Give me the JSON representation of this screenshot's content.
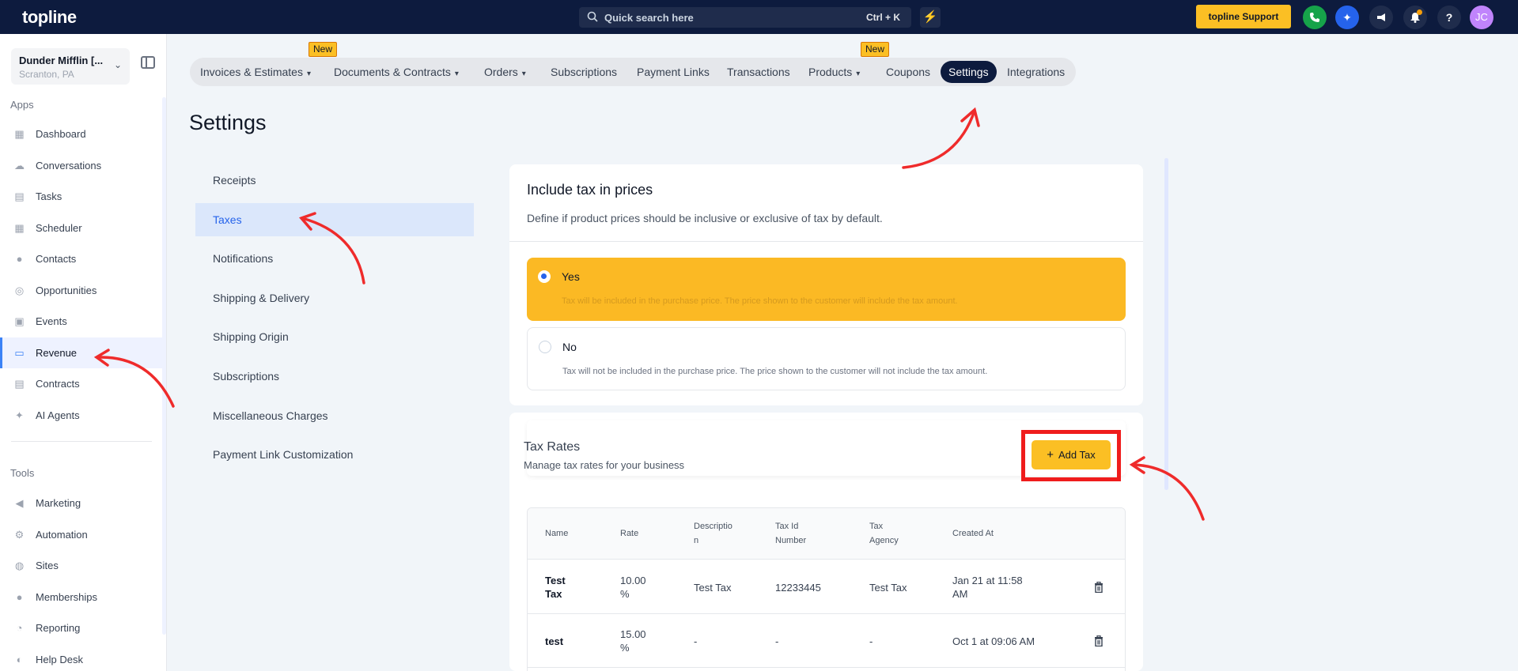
{
  "topbar": {
    "logo": "topline",
    "search_placeholder": "Quick search here",
    "search_shortcut": "Ctrl + K",
    "support_label": "topline Support",
    "avatar_initials": "JC"
  },
  "sidebar": {
    "account_name": "Dunder Mifflin [...",
    "account_location": "Scranton, PA",
    "apps_label": "Apps",
    "apps": [
      {
        "label": "Dashboard",
        "icon": "dashboard-icon"
      },
      {
        "label": "Conversations",
        "icon": "chat-icon"
      },
      {
        "label": "Tasks",
        "icon": "tasks-icon"
      },
      {
        "label": "Scheduler",
        "icon": "calendar-icon"
      },
      {
        "label": "Contacts",
        "icon": "user-icon"
      },
      {
        "label": "Opportunities",
        "icon": "target-icon"
      },
      {
        "label": "Events",
        "icon": "events-icon"
      },
      {
        "label": "Revenue",
        "icon": "card-icon",
        "active": true
      },
      {
        "label": "Contracts",
        "icon": "document-icon"
      },
      {
        "label": "AI Agents",
        "icon": "sparkle-icon"
      }
    ],
    "tools_label": "Tools",
    "tools": [
      {
        "label": "Marketing",
        "icon": "megaphone-icon"
      },
      {
        "label": "Automation",
        "icon": "gears-icon"
      },
      {
        "label": "Sites",
        "icon": "globe-icon"
      },
      {
        "label": "Memberships",
        "icon": "people-icon"
      },
      {
        "label": "Reporting",
        "icon": "pie-icon"
      },
      {
        "label": "Help Desk",
        "icon": "help-icon"
      }
    ]
  },
  "tabs": {
    "items": [
      {
        "label": "Invoices & Estimates",
        "dropdown": true,
        "badge": "New"
      },
      {
        "label": "Documents & Contracts",
        "dropdown": true
      },
      {
        "label": "Orders",
        "dropdown": true
      },
      {
        "label": "Subscriptions"
      },
      {
        "label": "Payment Links"
      },
      {
        "label": "Transactions"
      },
      {
        "label": "Products",
        "dropdown": true,
        "badge": "New"
      },
      {
        "label": "Coupons"
      },
      {
        "label": "Settings",
        "active": true
      },
      {
        "label": "Integrations"
      }
    ]
  },
  "page": {
    "title": "Settings"
  },
  "settings_menu": [
    {
      "label": "Receipts"
    },
    {
      "label": "Taxes",
      "active": true
    },
    {
      "label": "Notifications"
    },
    {
      "label": "Shipping & Delivery"
    },
    {
      "label": "Shipping Origin"
    },
    {
      "label": "Subscriptions"
    },
    {
      "label": "Miscellaneous Charges"
    },
    {
      "label": "Payment Link Customization"
    }
  ],
  "include_tax": {
    "title": "Include tax in prices",
    "description": "Define if product prices should be inclusive or exclusive of tax by default.",
    "options": [
      {
        "label": "Yes",
        "description": "Tax will be included in the purchase price. The price shown to the customer will include the tax amount.",
        "selected": true
      },
      {
        "label": "No",
        "description": "Tax will not be included in the purchase price. The price shown to the customer will not include the tax amount.",
        "selected": false
      }
    ]
  },
  "tax_rates": {
    "title": "Tax Rates",
    "subtitle": "Manage tax rates for your business",
    "add_button": "Add Tax",
    "columns": [
      "Name",
      "Rate",
      "Descriptio\nn",
      "Tax Id\nNumber",
      "Tax\nAgency",
      "Created At"
    ],
    "rows": [
      {
        "name": "Test\nTax",
        "rate": "10.00\n%",
        "description": "Test Tax",
        "tax_id": "12233445",
        "agency": "Test Tax",
        "created": "Jan 21 at 11:58\nAM"
      },
      {
        "name": "test",
        "rate": "15.00\n%",
        "description": "-",
        "tax_id": "-",
        "agency": "-",
        "created": "Oct 1 at 09:06 AM"
      }
    ]
  },
  "colors": {
    "topbar": "#0d1b3e",
    "accent": "#fbbf24",
    "active_blue": "#2563eb",
    "annotation_red": "#ef1c1c"
  }
}
